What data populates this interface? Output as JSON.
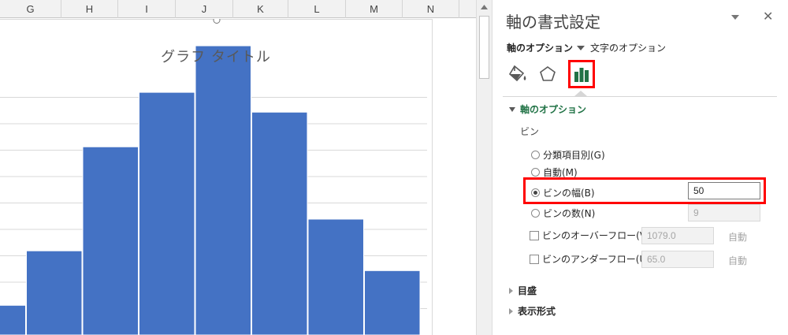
{
  "sheet": {
    "columns": [
      "G",
      "H",
      "I",
      "J",
      "K",
      "L",
      "M",
      "N"
    ]
  },
  "chart_data": {
    "type": "bar",
    "title": "グラフ タイトル",
    "values": [
      30,
      85,
      190,
      245,
      292,
      225,
      117,
      65
    ],
    "ylim": [
      0,
      300
    ],
    "grid": true,
    "bar_color": "#4472c4"
  },
  "pane": {
    "title": "軸の書式設定",
    "tab_axis": "軸のオプション",
    "tab_text": "文字のオプション",
    "icons": [
      "paint-bucket-icon",
      "pentagon-icon",
      "bar-chart-icon"
    ],
    "section_axis": "軸のオプション",
    "bin_label": "ビン",
    "options": {
      "category": "分類項目別(G)",
      "auto": "自動(M)",
      "width": "ビンの幅(B)",
      "count": "ビンの数(N)",
      "overflow": "ビンのオーバーフロー(V)",
      "underflow": "ビンのアンダーフロー(U)"
    },
    "values": {
      "width": "50",
      "count": "9",
      "overflow": "1079.0",
      "underflow": "65.0"
    },
    "auto_label": "自動",
    "section_ticks": "目盛",
    "section_format": "表示形式",
    "accent_color": "#217346",
    "highlight_color": "#ff0000"
  }
}
